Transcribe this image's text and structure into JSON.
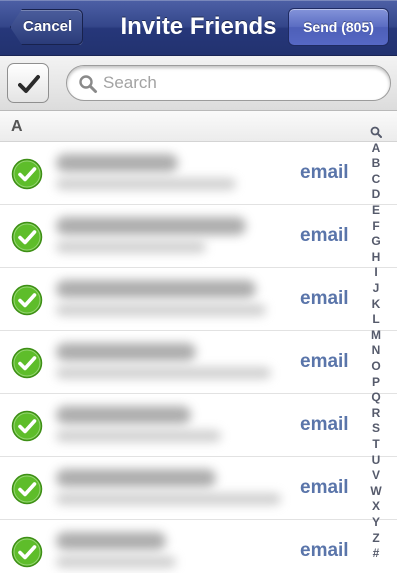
{
  "nav": {
    "title": "Invite Friends",
    "cancel_label": "Cancel",
    "send_label": "Send (805)"
  },
  "search": {
    "placeholder": "Search",
    "value": ""
  },
  "section": {
    "header": "A"
  },
  "contacts": [
    {
      "selected": true,
      "method": "email"
    },
    {
      "selected": true,
      "method": "email"
    },
    {
      "selected": true,
      "method": "email"
    },
    {
      "selected": true,
      "method": "email"
    },
    {
      "selected": true,
      "method": "email"
    },
    {
      "selected": true,
      "method": "email"
    },
    {
      "selected": true,
      "method": "email"
    }
  ],
  "index": [
    "search-icon",
    "A",
    "B",
    "C",
    "D",
    "E",
    "F",
    "G",
    "H",
    "I",
    "J",
    "K",
    "L",
    "M",
    "N",
    "O",
    "P",
    "Q",
    "R",
    "S",
    "T",
    "U",
    "V",
    "W",
    "X",
    "Y",
    "Z",
    "#"
  ],
  "colors": {
    "nav_bar": "#2f4184",
    "send_button": "#5a6cc2",
    "check_green": "#5ebd2a",
    "email_link": "#5a75aa"
  },
  "icons": {
    "select_all": "checkmark-icon",
    "search": "magnifier-icon",
    "row_check": "green-check-circle-icon"
  }
}
